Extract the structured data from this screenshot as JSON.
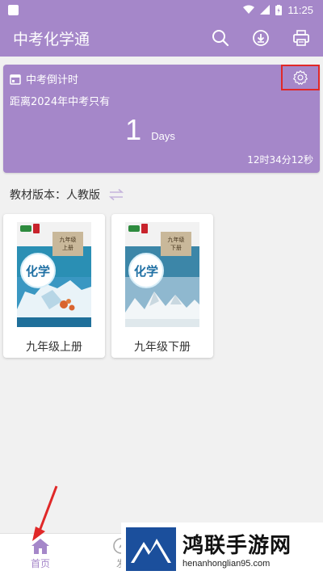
{
  "status_bar": {
    "time": "11:25"
  },
  "app_bar": {
    "title": "中考化学通",
    "icons": [
      "search-icon",
      "download-icon",
      "print-icon"
    ]
  },
  "countdown": {
    "header": "中考倒计时",
    "subtitle": "距离2024年中考只有",
    "days_value": "1",
    "days_unit": "Days",
    "remaining": "12时34分12秒"
  },
  "edition": {
    "label": "教材版本：人教版"
  },
  "books": [
    {
      "name": "九年级上册",
      "cover_title": "化学",
      "grade": "九年级",
      "volume": "上册"
    },
    {
      "name": "九年级下册",
      "cover_title": "化学",
      "grade": "九年级",
      "volume": "下册"
    }
  ],
  "bottom_nav": {
    "home_label": "首页",
    "find_label": "发"
  },
  "watermark": {
    "name": "鸿联手游网",
    "url": "henanhonglian95.com"
  },
  "colors": {
    "primary": "#a587c9",
    "highlight_box": "#e02828",
    "arrow": "#e02828"
  }
}
